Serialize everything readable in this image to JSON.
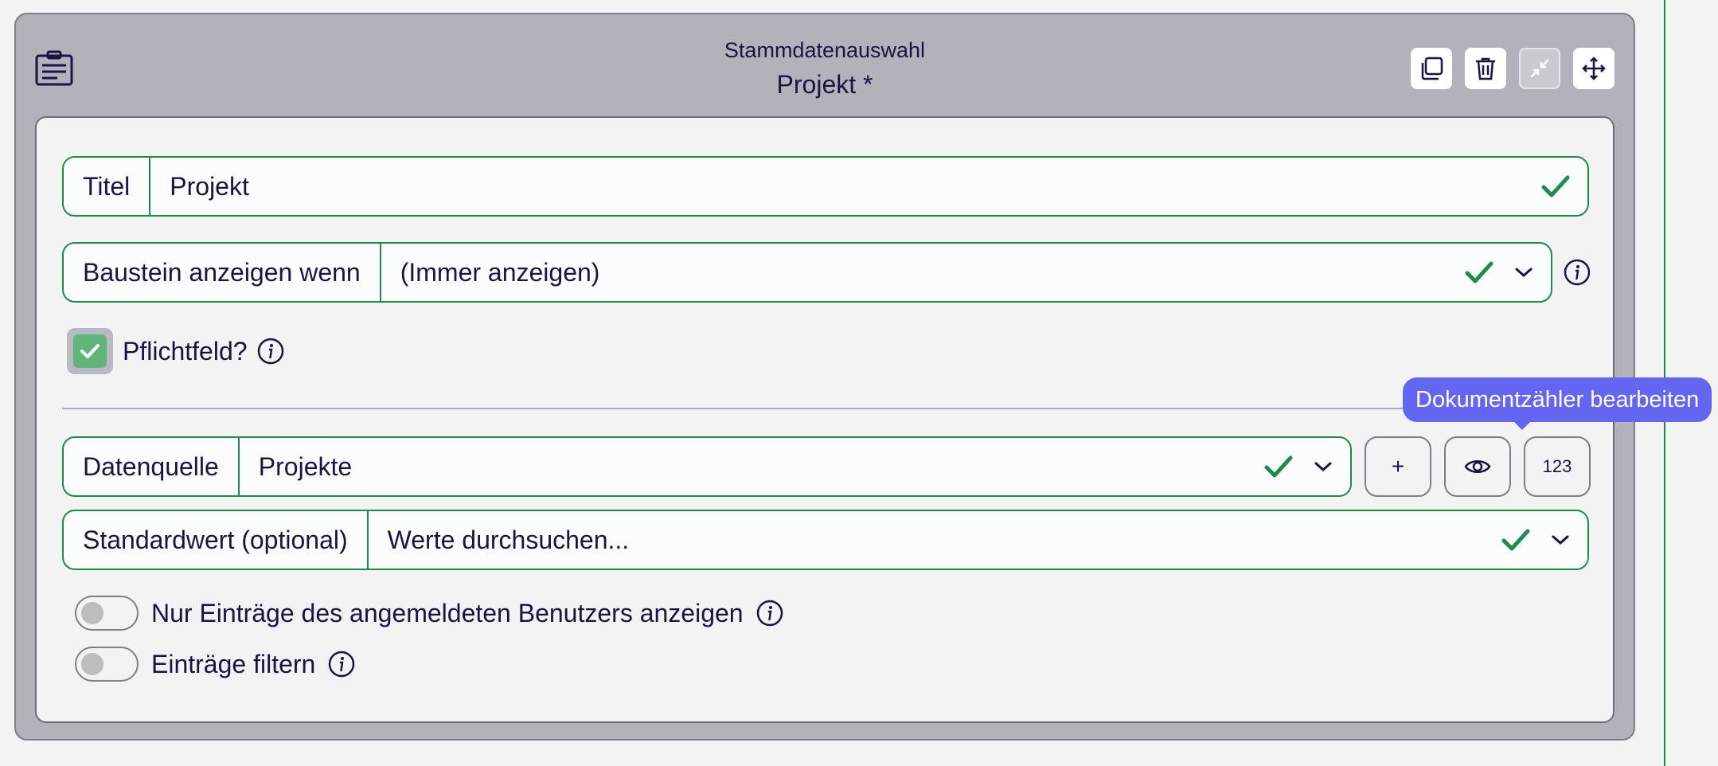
{
  "card": {
    "subtitle": "Stammdatenauswahl",
    "title": "Projekt *"
  },
  "fields": {
    "titel": {
      "label": "Titel",
      "value": "Projekt"
    },
    "condition": {
      "label": "Baustein anzeigen wenn",
      "value": "(Immer anzeigen)"
    },
    "required": {
      "label": "Pflichtfeld?",
      "checked": true
    },
    "datasource": {
      "label": "Datenquelle",
      "value": "Projekte"
    },
    "default": {
      "label": "Standardwert (optional)",
      "placeholder": "Werte durchsuchen..."
    }
  },
  "datasource_buttons": {
    "add": "+",
    "counter": "123"
  },
  "tooltip": "Dokumentzähler bearbeiten",
  "toggles": {
    "own_entries": {
      "label": "Nur Einträge des angemeldeten Benutzers anzeigen",
      "on": false
    },
    "filter": {
      "label": "Einträge filtern",
      "on": false
    }
  },
  "colors": {
    "valid": "#1e8a4c",
    "tooltip": "#6366f1",
    "checkbox": "#5fb57a"
  },
  "icons": [
    "clipboard-icon",
    "copy-icon",
    "trash-icon",
    "minimize-icon",
    "move-icon",
    "check-icon",
    "chevron-down-icon",
    "info-icon",
    "eye-icon"
  ]
}
